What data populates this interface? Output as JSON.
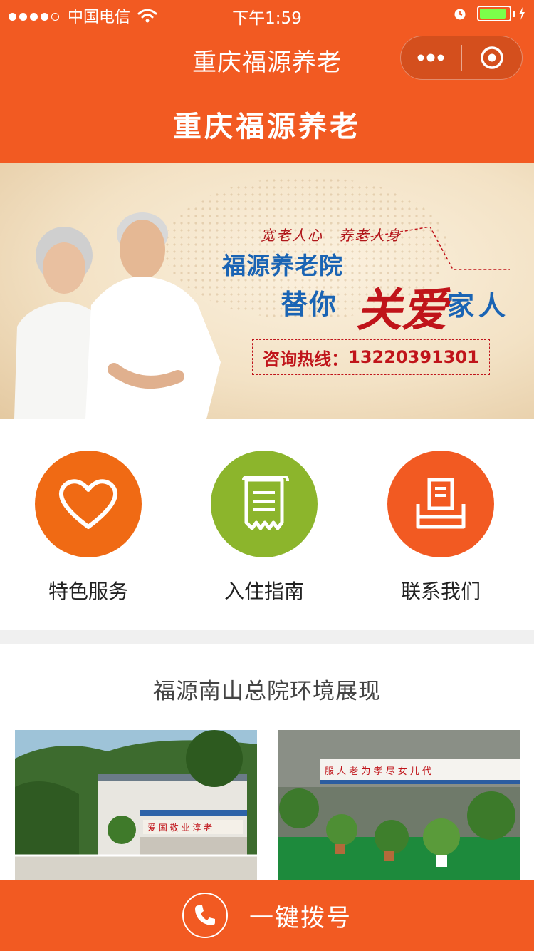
{
  "status_bar": {
    "signal_icon": "signal-dots-icon",
    "carrier": "中国电信",
    "time": "下午1:59",
    "battery_level": 0.9
  },
  "nav": {
    "title": "重庆福源养老",
    "more_icon": "more-dots-icon",
    "close_icon": "target-circle-icon"
  },
  "header": {
    "title": "重庆福源养老"
  },
  "banner": {
    "slogan": "宽老人心　养老人身",
    "org_name": "福源养老院",
    "line2_a": "替你",
    "line2_care": "关爱",
    "line2_b": "家人",
    "hotline_label": "咨询热线：",
    "hotline_number": "13220391301"
  },
  "quick_menu": {
    "items": [
      {
        "label": "特色服务",
        "icon": "heart-icon",
        "color": "#f06a14"
      },
      {
        "label": "入住指南",
        "icon": "scroll-document-icon",
        "color": "#8cb52c"
      },
      {
        "label": "联系我们",
        "icon": "printer-icon",
        "color": "#f25a22"
      }
    ]
  },
  "environment": {
    "title": "福源南山总院环境展现",
    "photo1_sign": "爱 国 敬 业 淳 老",
    "photo2_sign": "服 人 老 为 孝 尽 女 儿 代"
  },
  "call_bar": {
    "label": "一键拨号",
    "icon": "phone-icon"
  },
  "colors": {
    "brand": "#f25a22",
    "green": "#8cb52c",
    "orange": "#f06a14",
    "banner_blue": "#1a64b4",
    "banner_red": "#c0141a"
  }
}
